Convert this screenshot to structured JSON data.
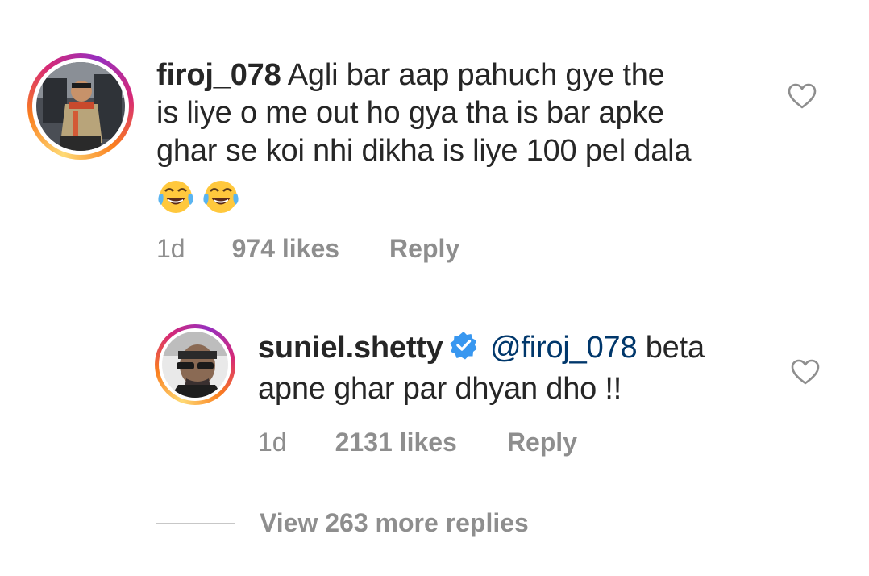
{
  "comments": [
    {
      "username": "firoj_078",
      "text_lines": [
        "Agli bar aap pahuch gye the",
        "is liye o me out ho gya tha is bar apke",
        "ghar se koi nhi dikha is liye 100 pel dala"
      ],
      "emojis": [
        "😂",
        "😂"
      ],
      "time": "1d",
      "likes": "974 likes",
      "reply": "Reply",
      "icon": "heart-outline-icon"
    }
  ],
  "reply": {
    "username": "suniel.shetty",
    "verified": true,
    "mention": "@firoj_078",
    "text_first": "beta",
    "text_second": "apne ghar par dhyan dho !!",
    "time": "1d",
    "likes": "2131 likes",
    "reply": "Reply",
    "icon": "heart-outline-icon"
  },
  "view_more": "View 263 more replies",
  "colors": {
    "text": "#262626",
    "secondary": "#8e8e8e",
    "mention": "#00376b",
    "verified": "#3897f0"
  }
}
